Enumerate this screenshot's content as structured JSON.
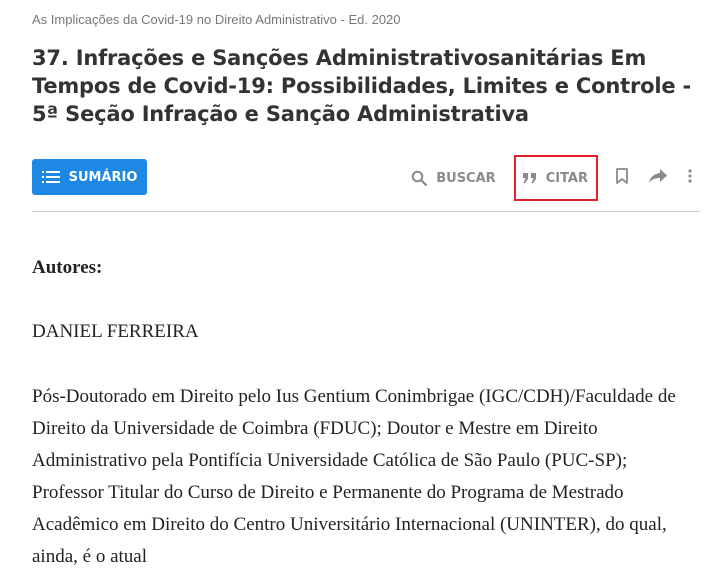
{
  "breadcrumb": "As Implicações da Covid-19 no Direito Administrativo - Ed. 2020",
  "title": "37. Infrações e Sanções Administrativosanitárias Em Tempos de Covid-19: Possibilidades, Limites e Controle - 5ª Seção Infração e Sanção Administrativa",
  "toolbar": {
    "summary_label": "SUMÁRIO",
    "search_label": "BUSCAR",
    "cite_label": "CITAR",
    "accent_color": "#1e88e5",
    "highlight_color": "#e0202a",
    "icons": [
      "list-icon",
      "search-icon",
      "quote-icon",
      "bookmark-icon",
      "share-icon",
      "more-vertical-icon"
    ]
  },
  "content": {
    "authors_heading": "Autores:",
    "author_name": "DANIEL FERREIRA",
    "author_bio": "Pós-Doutorado em Direito pelo Ius Gentium Conimbrigae (IGC/CDH)/Faculdade de Direito da Universidade de Coimbra (FDUC); Doutor e Mestre em Direito Administrativo pela Pontifícia Universidade Católica de São Paulo (PUC-SP); Professor Titular do Curso de Direito e Permanente do Programa de Mestrado Acadêmico em Direito do Centro Universitário Internacional (UNINTER), do qual, ainda, é o atual"
  }
}
